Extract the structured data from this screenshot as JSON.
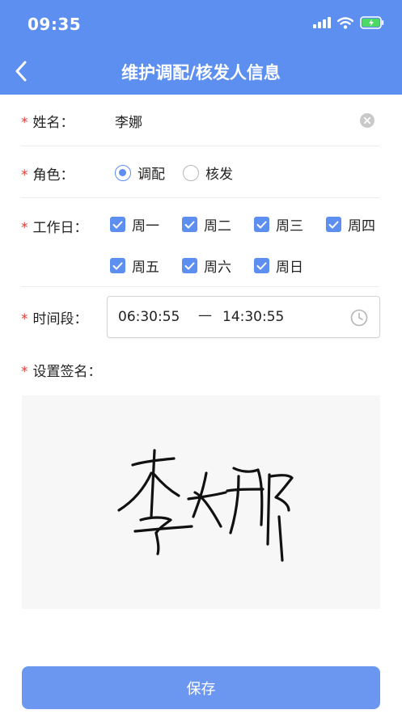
{
  "status_bar": {
    "time": "09:35"
  },
  "nav": {
    "title": "维护调配/核发人信息"
  },
  "form": {
    "required_mark": "*",
    "name": {
      "label": "姓名：",
      "value": "李娜"
    },
    "role": {
      "label": "角色：",
      "options": [
        {
          "label": "调配",
          "selected": true
        },
        {
          "label": "核发",
          "selected": false
        }
      ]
    },
    "workdays": {
      "label": "工作日：",
      "days": [
        {
          "label": "周一",
          "checked": true
        },
        {
          "label": "周二",
          "checked": true
        },
        {
          "label": "周三",
          "checked": true
        },
        {
          "label": "周四",
          "checked": true
        },
        {
          "label": "周五",
          "checked": true
        },
        {
          "label": "周六",
          "checked": true
        },
        {
          "label": "周日",
          "checked": true
        }
      ]
    },
    "time_range": {
      "label": "时间段：",
      "start": "06:30:55",
      "separator": "—",
      "end": "14:30:55"
    },
    "signature": {
      "label": "设置签名："
    }
  },
  "footer": {
    "save_label": "保存"
  },
  "colors": {
    "primary": "#5d8ff0",
    "button": "#6c97f1",
    "required": "#e53935"
  },
  "icons": [
    "back-arrow-icon",
    "signal-icon",
    "wifi-icon",
    "battery-icon",
    "clear-icon",
    "clock-icon",
    "radio-icon",
    "checkbox-icon"
  ]
}
